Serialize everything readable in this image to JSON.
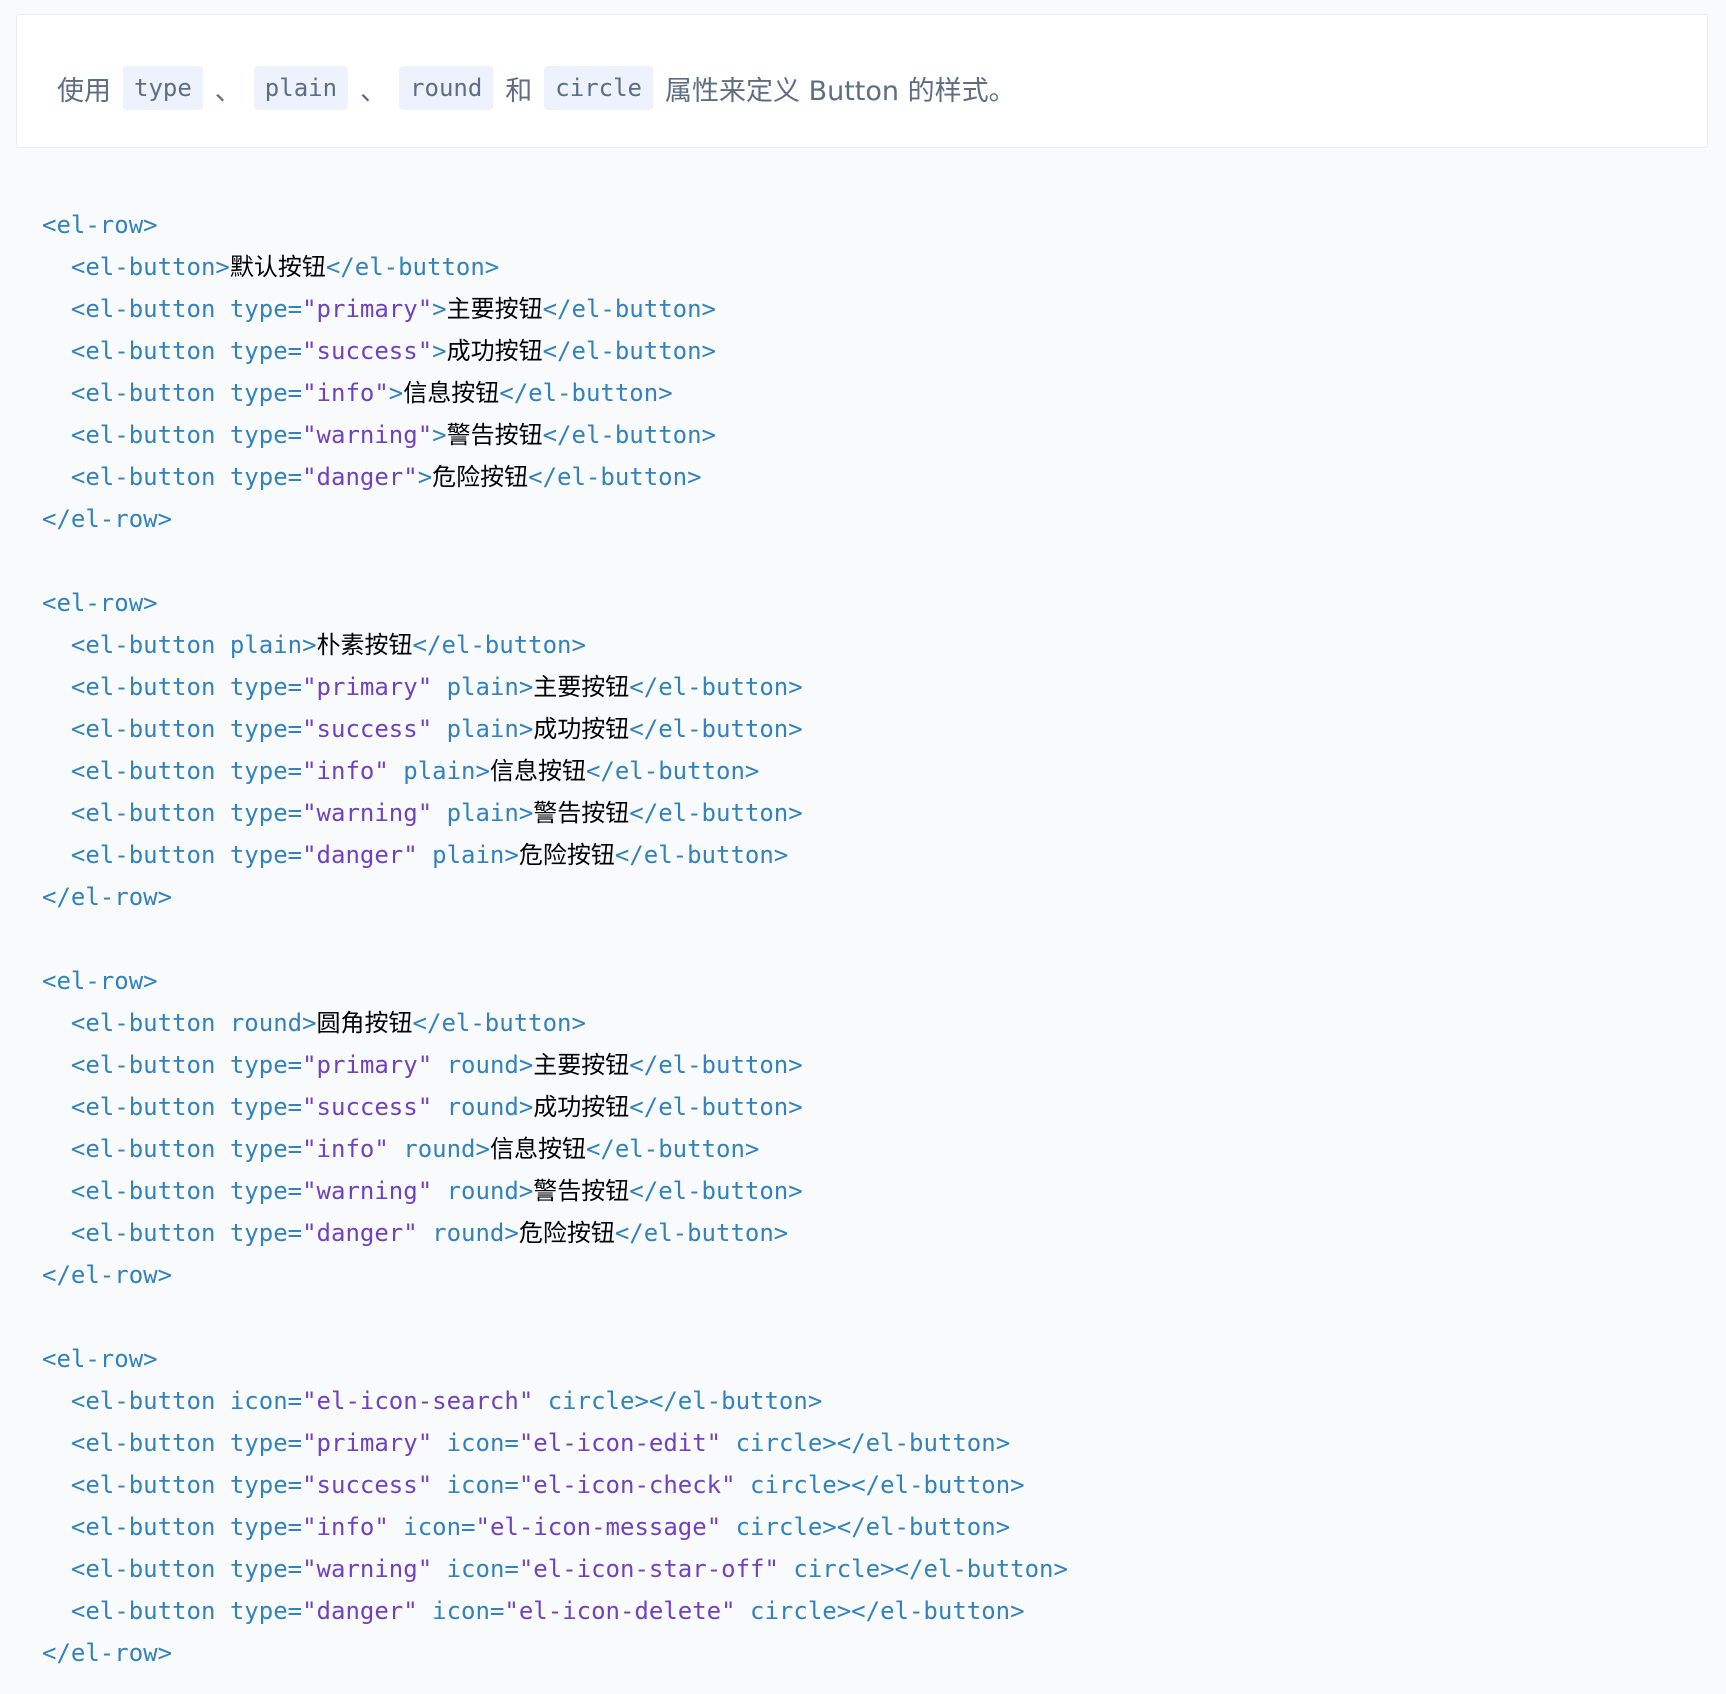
{
  "description": {
    "prefix": "使用",
    "code_type": "type",
    "sep1": "、",
    "code_plain": "plain",
    "sep2": "、",
    "code_round": "round",
    "and": "和",
    "code_circle": "circle",
    "suffix": "属性来定义 Button 的样式。"
  },
  "code_lines": [
    [
      [
        "tag",
        "<el-row>"
      ]
    ],
    [
      [
        "tag",
        "  <el-button>"
      ],
      [
        "txt",
        "默认按钮"
      ],
      [
        "tag",
        "</el-button>"
      ]
    ],
    [
      [
        "tag",
        "  <el-button "
      ],
      [
        "attr",
        "type="
      ],
      [
        "str",
        "\"primary\""
      ],
      [
        "tag",
        ">"
      ],
      [
        "txt",
        "主要按钮"
      ],
      [
        "tag",
        "</el-button>"
      ]
    ],
    [
      [
        "tag",
        "  <el-button "
      ],
      [
        "attr",
        "type="
      ],
      [
        "str",
        "\"success\""
      ],
      [
        "tag",
        ">"
      ],
      [
        "txt",
        "成功按钮"
      ],
      [
        "tag",
        "</el-button>"
      ]
    ],
    [
      [
        "tag",
        "  <el-button "
      ],
      [
        "attr",
        "type="
      ],
      [
        "str",
        "\"info\""
      ],
      [
        "tag",
        ">"
      ],
      [
        "txt",
        "信息按钮"
      ],
      [
        "tag",
        "</el-button>"
      ]
    ],
    [
      [
        "tag",
        "  <el-button "
      ],
      [
        "attr",
        "type="
      ],
      [
        "str",
        "\"warning\""
      ],
      [
        "tag",
        ">"
      ],
      [
        "txt",
        "警告按钮"
      ],
      [
        "tag",
        "</el-button>"
      ]
    ],
    [
      [
        "tag",
        "  <el-button "
      ],
      [
        "attr",
        "type="
      ],
      [
        "str",
        "\"danger\""
      ],
      [
        "tag",
        ">"
      ],
      [
        "txt",
        "危险按钮"
      ],
      [
        "tag",
        "</el-button>"
      ]
    ],
    [
      [
        "tag",
        "</el-row>"
      ]
    ],
    [],
    [
      [
        "tag",
        "<el-row>"
      ]
    ],
    [
      [
        "tag",
        "  <el-button "
      ],
      [
        "attr",
        "plain"
      ],
      [
        "tag",
        ">"
      ],
      [
        "txt",
        "朴素按钮"
      ],
      [
        "tag",
        "</el-button>"
      ]
    ],
    [
      [
        "tag",
        "  <el-button "
      ],
      [
        "attr",
        "type="
      ],
      [
        "str",
        "\"primary\""
      ],
      [
        "attr",
        " plain"
      ],
      [
        "tag",
        ">"
      ],
      [
        "txt",
        "主要按钮"
      ],
      [
        "tag",
        "</el-button>"
      ]
    ],
    [
      [
        "tag",
        "  <el-button "
      ],
      [
        "attr",
        "type="
      ],
      [
        "str",
        "\"success\""
      ],
      [
        "attr",
        " plain"
      ],
      [
        "tag",
        ">"
      ],
      [
        "txt",
        "成功按钮"
      ],
      [
        "tag",
        "</el-button>"
      ]
    ],
    [
      [
        "tag",
        "  <el-button "
      ],
      [
        "attr",
        "type="
      ],
      [
        "str",
        "\"info\""
      ],
      [
        "attr",
        " plain"
      ],
      [
        "tag",
        ">"
      ],
      [
        "txt",
        "信息按钮"
      ],
      [
        "tag",
        "</el-button>"
      ]
    ],
    [
      [
        "tag",
        "  <el-button "
      ],
      [
        "attr",
        "type="
      ],
      [
        "str",
        "\"warning\""
      ],
      [
        "attr",
        " plain"
      ],
      [
        "tag",
        ">"
      ],
      [
        "txt",
        "警告按钮"
      ],
      [
        "tag",
        "</el-button>"
      ]
    ],
    [
      [
        "tag",
        "  <el-button "
      ],
      [
        "attr",
        "type="
      ],
      [
        "str",
        "\"danger\""
      ],
      [
        "attr",
        " plain"
      ],
      [
        "tag",
        ">"
      ],
      [
        "txt",
        "危险按钮"
      ],
      [
        "tag",
        "</el-button>"
      ]
    ],
    [
      [
        "tag",
        "</el-row>"
      ]
    ],
    [],
    [
      [
        "tag",
        "<el-row>"
      ]
    ],
    [
      [
        "tag",
        "  <el-button "
      ],
      [
        "attr",
        "round"
      ],
      [
        "tag",
        ">"
      ],
      [
        "txt",
        "圆角按钮"
      ],
      [
        "tag",
        "</el-button>"
      ]
    ],
    [
      [
        "tag",
        "  <el-button "
      ],
      [
        "attr",
        "type="
      ],
      [
        "str",
        "\"primary\""
      ],
      [
        "attr",
        " round"
      ],
      [
        "tag",
        ">"
      ],
      [
        "txt",
        "主要按钮"
      ],
      [
        "tag",
        "</el-button>"
      ]
    ],
    [
      [
        "tag",
        "  <el-button "
      ],
      [
        "attr",
        "type="
      ],
      [
        "str",
        "\"success\""
      ],
      [
        "attr",
        " round"
      ],
      [
        "tag",
        ">"
      ],
      [
        "txt",
        "成功按钮"
      ],
      [
        "tag",
        "</el-button>"
      ]
    ],
    [
      [
        "tag",
        "  <el-button "
      ],
      [
        "attr",
        "type="
      ],
      [
        "str",
        "\"info\""
      ],
      [
        "attr",
        " round"
      ],
      [
        "tag",
        ">"
      ],
      [
        "txt",
        "信息按钮"
      ],
      [
        "tag",
        "</el-button>"
      ]
    ],
    [
      [
        "tag",
        "  <el-button "
      ],
      [
        "attr",
        "type="
      ],
      [
        "str",
        "\"warning\""
      ],
      [
        "attr",
        " round"
      ],
      [
        "tag",
        ">"
      ],
      [
        "txt",
        "警告按钮"
      ],
      [
        "tag",
        "</el-button>"
      ]
    ],
    [
      [
        "tag",
        "  <el-button "
      ],
      [
        "attr",
        "type="
      ],
      [
        "str",
        "\"danger\""
      ],
      [
        "attr",
        " round"
      ],
      [
        "tag",
        ">"
      ],
      [
        "txt",
        "危险按钮"
      ],
      [
        "tag",
        "</el-button>"
      ]
    ],
    [
      [
        "tag",
        "</el-row>"
      ]
    ],
    [],
    [
      [
        "tag",
        "<el-row>"
      ]
    ],
    [
      [
        "tag",
        "  <el-button "
      ],
      [
        "attr",
        "icon="
      ],
      [
        "str",
        "\"el-icon-search\""
      ],
      [
        "attr",
        " circle"
      ],
      [
        "tag",
        "></el-button>"
      ]
    ],
    [
      [
        "tag",
        "  <el-button "
      ],
      [
        "attr",
        "type="
      ],
      [
        "str",
        "\"primary\""
      ],
      [
        "attr",
        " icon="
      ],
      [
        "str",
        "\"el-icon-edit\""
      ],
      [
        "attr",
        " circle"
      ],
      [
        "tag",
        "></el-button>"
      ]
    ],
    [
      [
        "tag",
        "  <el-button "
      ],
      [
        "attr",
        "type="
      ],
      [
        "str",
        "\"success\""
      ],
      [
        "attr",
        " icon="
      ],
      [
        "str",
        "\"el-icon-check\""
      ],
      [
        "attr",
        " circle"
      ],
      [
        "tag",
        "></el-button>"
      ]
    ],
    [
      [
        "tag",
        "  <el-button "
      ],
      [
        "attr",
        "type="
      ],
      [
        "str",
        "\"info\""
      ],
      [
        "attr",
        " icon="
      ],
      [
        "str",
        "\"el-icon-message\""
      ],
      [
        "attr",
        " circle"
      ],
      [
        "tag",
        "></el-button>"
      ]
    ],
    [
      [
        "tag",
        "  <el-button "
      ],
      [
        "attr",
        "type="
      ],
      [
        "str",
        "\"warning\""
      ],
      [
        "attr",
        " icon="
      ],
      [
        "str",
        "\"el-icon-star-off\""
      ],
      [
        "attr",
        " circle"
      ],
      [
        "tag",
        "></el-button>"
      ]
    ],
    [
      [
        "tag",
        "  <el-button "
      ],
      [
        "attr",
        "type="
      ],
      [
        "str",
        "\"danger\""
      ],
      [
        "attr",
        " icon="
      ],
      [
        "str",
        "\"el-icon-delete\""
      ],
      [
        "attr",
        " circle"
      ],
      [
        "tag",
        "></el-button>"
      ]
    ],
    [
      [
        "tag",
        "</el-row>"
      ]
    ]
  ]
}
